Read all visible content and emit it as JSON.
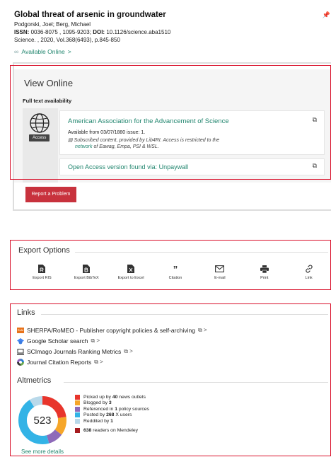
{
  "record": {
    "title": "Global threat of arsenic in groundwater",
    "authors": "Podgorski, Joel; Berg, Michael",
    "issn_label": "ISSN:",
    "issn_value": " 0036-8075 , 1095-9203; ",
    "doi_label": "DOI:",
    "doi_value": " 10.1126/science.aba1510",
    "source": "Science. , 2020, Vol.368(6493), p.845-850",
    "available_online": "Available Online",
    "available_chevron": ">",
    "pin_icon": "pin-icon"
  },
  "view_online": {
    "title": "View Online",
    "subtitle": "Full text availability",
    "access_badge": "Access",
    "provider": {
      "name": "American Association for the Advancement of Science",
      "available_from": "Available from 03/07/1880 issue: 1.",
      "note_prefix": "Subscribed content, provided by Lib4RI. Access is restricted to the",
      "note_link": "network",
      "note_suffix": " of Eawag, Empa, PSI & WSL."
    },
    "open_access": "Open Access version found via: Unpaywall"
  },
  "report_button": "Report a Problem",
  "export": {
    "title": "Export Options",
    "items": [
      {
        "label": "Export RIS",
        "icon": "file-ris-icon"
      },
      {
        "label": "Export BibTeX",
        "icon": "file-bibtex-icon"
      },
      {
        "label": "Export to Excel",
        "icon": "file-excel-icon"
      },
      {
        "label": "Citation",
        "icon": "quote-icon"
      },
      {
        "label": "E-mail",
        "icon": "envelope-icon"
      },
      {
        "label": "Print",
        "icon": "printer-icon"
      },
      {
        "label": "Link",
        "icon": "link-icon"
      }
    ]
  },
  "links": {
    "title": "Links",
    "items": [
      {
        "label": "SHERPA/RoMEO - Publisher copyright policies & self-archiving",
        "icon": "sherpa-romeo-icon"
      },
      {
        "label": "Google Scholar search",
        "icon": "google-scholar-icon"
      },
      {
        "label": "SCImago Journals Ranking Metrics",
        "icon": "scimago-icon"
      },
      {
        "label": "Journal Citation Reports",
        "icon": "jcr-icon"
      }
    ]
  },
  "altmetrics": {
    "title": "Altmetrics",
    "score": "523",
    "metrics": [
      {
        "prefix": "Picked up by ",
        "count": "40",
        "suffix": " news outlets",
        "color": "#e8352c"
      },
      {
        "prefix": "Blogged by ",
        "count": "3",
        "suffix": "",
        "color": "#f6a629"
      },
      {
        "prefix": "Referenced in ",
        "count": "1",
        "suffix": " policy sources",
        "color": "#8e6ab9"
      },
      {
        "prefix": "Posted by ",
        "count": "268",
        "suffix": " X users",
        "color": "#33b3e6"
      },
      {
        "prefix": "Reddited by ",
        "count": "1",
        "suffix": "",
        "color": "#b9d9ea"
      }
    ],
    "mendeley": {
      "count": "638",
      "suffix": " readers on Mendeley",
      "color": "#a61c1f"
    },
    "see_more": "See more details"
  },
  "colors": {
    "accent_green": "#22866f",
    "highlight_red": "#d9102a",
    "button_red": "#c8323d"
  }
}
